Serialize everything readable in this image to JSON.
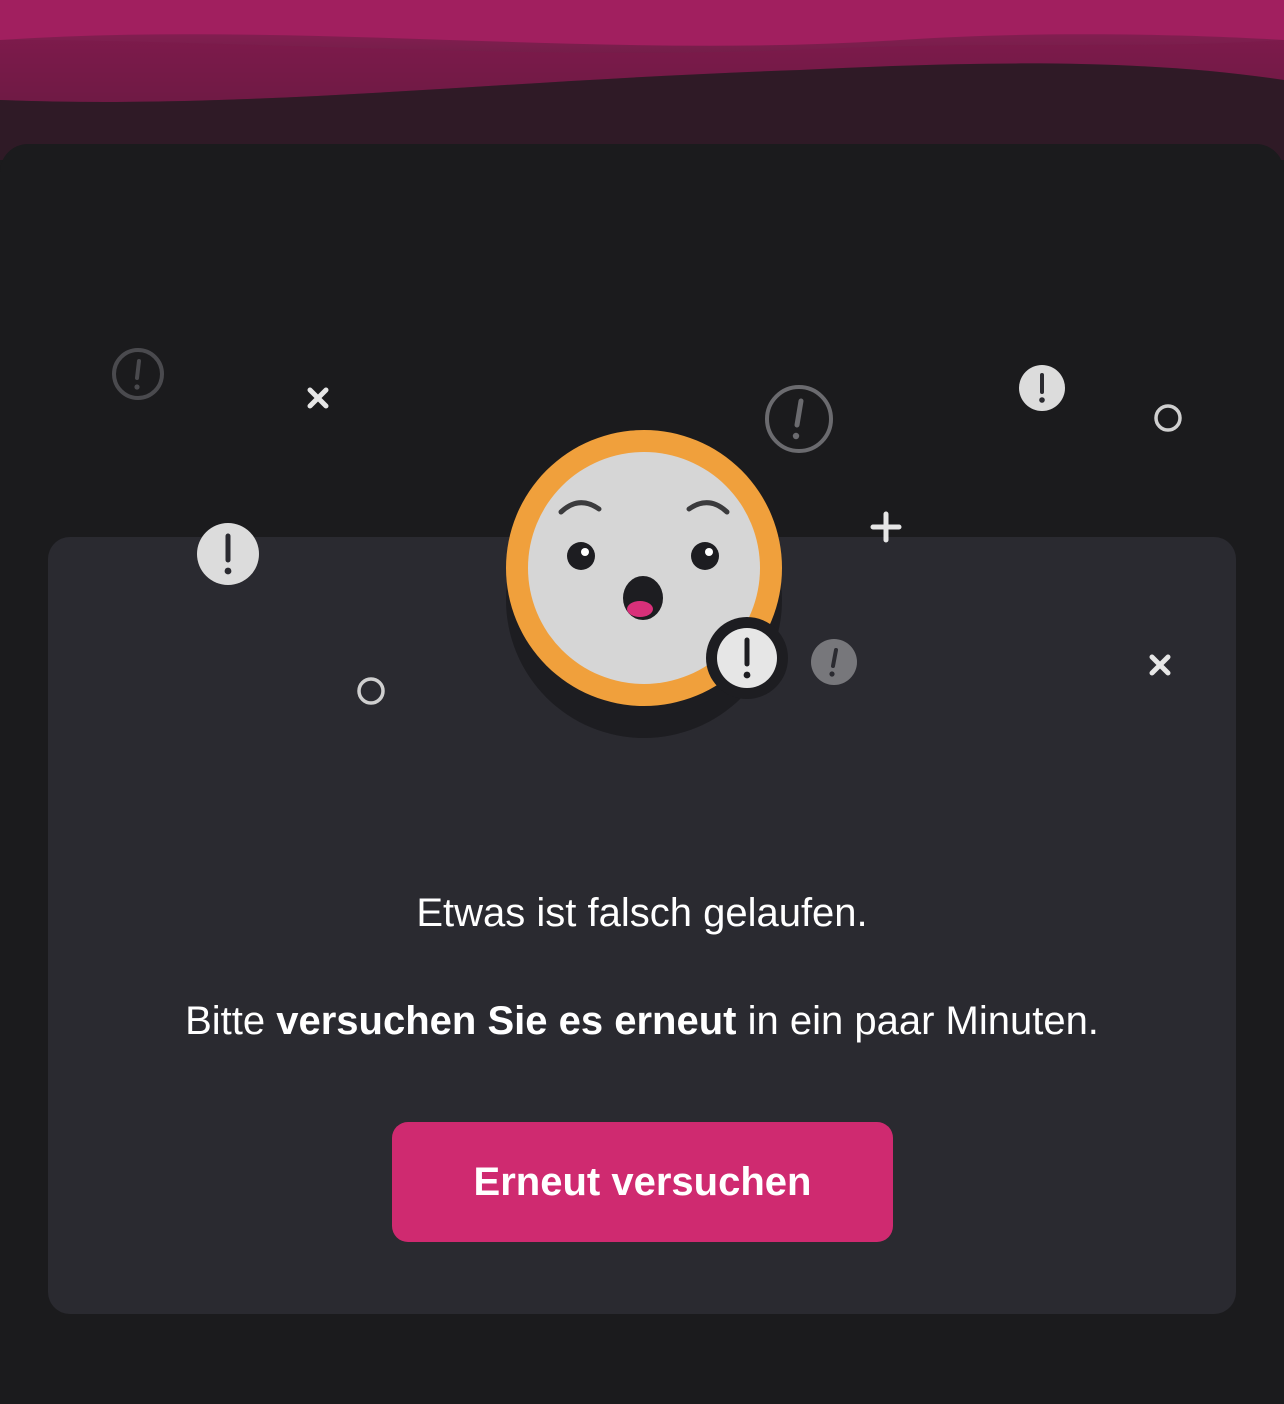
{
  "colors": {
    "background": "#1b1b1d",
    "card": "#2a2a30",
    "accent": "#cf2a70",
    "header_wave": "#8f1b56",
    "emoji_ring": "#f0a03c",
    "emoji_face": "#d6d6d6"
  },
  "illustration": {
    "icons": [
      "surprised-face-icon",
      "exclamation-icon",
      "close-icon",
      "plus-icon",
      "circle-icon"
    ]
  },
  "error": {
    "title": "Etwas ist falsch gelaufen.",
    "message_start": "Bitte",
    "message_bold": "versuchen Sie es erneut",
    "message_end": "in ein paar Minuten."
  },
  "retry_button": {
    "label": "Erneut versuchen"
  }
}
